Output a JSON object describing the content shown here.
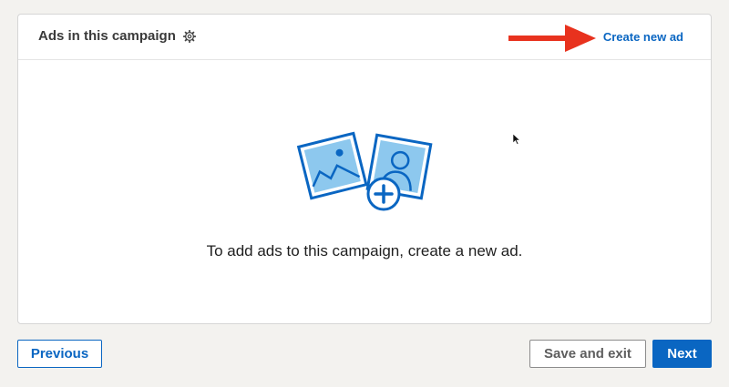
{
  "card": {
    "title": "Ads in this campaign",
    "settings_icon": "gear-icon",
    "create_link_label": "Create new ad",
    "annotation_icon": "red-arrow-icon",
    "empty_state": {
      "illustration_icon": "add-images-illustration",
      "message": "To add ads to this campaign, create a new ad."
    }
  },
  "footer": {
    "previous_label": "Previous",
    "save_exit_label": "Save and exit",
    "next_label": "Next"
  },
  "colors": {
    "accent": "#0a66c2",
    "arrow": "#e8321e",
    "background": "#f3f2ef"
  }
}
